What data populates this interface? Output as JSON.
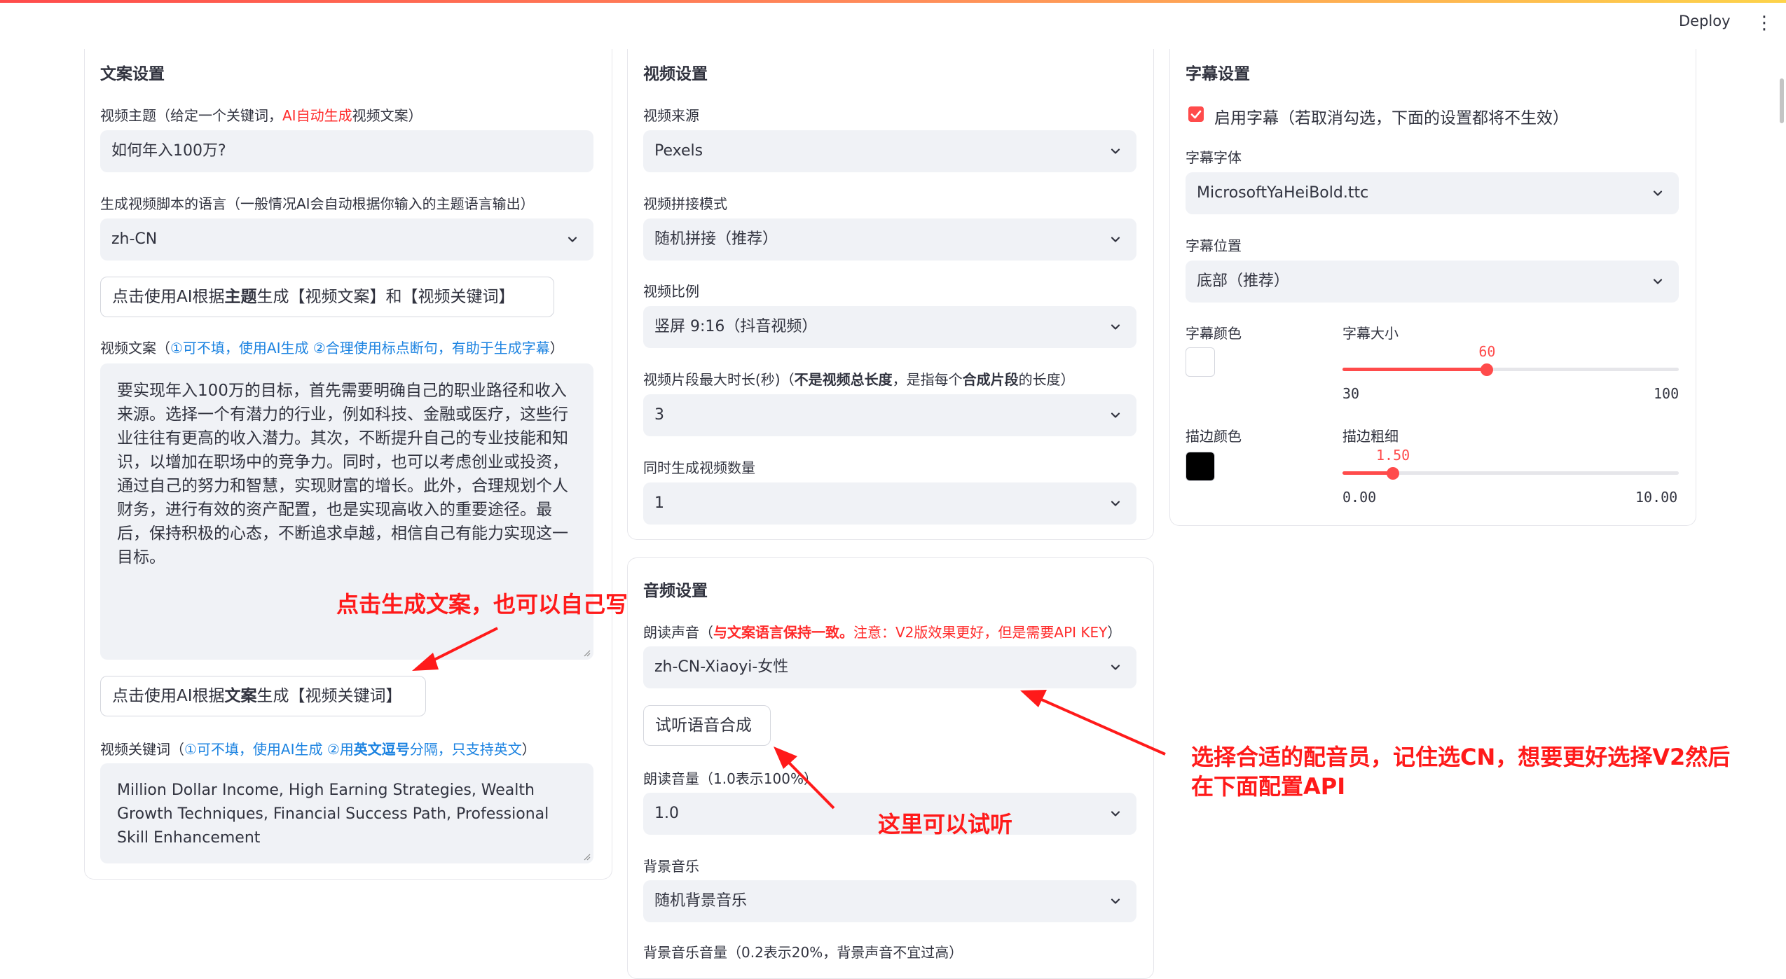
{
  "header": {
    "deploy_label": "Deploy",
    "menu_icon": "kebab-menu-icon"
  },
  "copy_settings": {
    "title": "文案设置",
    "topic_label_1": "视频主题（给定一个关键词，",
    "topic_label_red": "AI自动生成",
    "topic_label_2": "视频文案）",
    "topic_value": "如何年入100万?",
    "language_label": "生成视频脚本的语言（一般情况AI会自动根据你输入的主题语言输出）",
    "language_value": "zh-CN",
    "btn_generate_1": "点击使用AI根据",
    "btn_generate_bold": "主题",
    "btn_generate_2": "生成【视频文案】和【视频关键词】",
    "script_label_1": "视频文案（",
    "script_label_blue": "①可不填，使用AI生成 ②合理使用标点断句，有助于生成字幕",
    "script_label_2": "）",
    "script_text": "要实现年入100万的目标，首先需要明确自己的职业路径和收入来源。选择一个有潜力的行业，例如科技、金融或医疗，这些行业往往有更高的收入潜力。其次，不断提升自己的专业技能和知识，以增加在职场中的竞争力。同时，也可以考虑创业或投资，通过自己的努力和智慧，实现财富的增长。此外，合理规划个人财务，进行有效的资产配置，也是实现高收入的重要途径。最后，保持积极的心态，不断追求卓越，相信自己有能力实现这一目标。",
    "btn_keywords_1": "点击使用AI根据",
    "btn_keywords_bold": "文案",
    "btn_keywords_2": "生成【视频关键词】",
    "keywords_label_1": "视频关键词（",
    "keywords_label_blue_1": "①可不填，使用AI生成 ②用",
    "keywords_label_bold": "英文逗号",
    "keywords_label_blue_2": "分隔，只支持英文",
    "keywords_label_2": "）",
    "keywords_text": "Million Dollar Income, High Earning Strategies, Wealth Growth Techniques, Financial Success Path, Professional Skill Enhancement"
  },
  "video_settings": {
    "title": "视频设置",
    "source_label": "视频来源",
    "source_value": "Pexels",
    "concat_label": "视频拼接模式",
    "concat_value": "随机拼接（推荐）",
    "ratio_label": "视频比例",
    "ratio_value": "竖屏 9:16（抖音视频）",
    "clip_label_1": "视频片段最大时长(秒)（",
    "clip_label_bold_1": "不是视频总长度",
    "clip_label_2": "，是指每个",
    "clip_label_bold_2": "合成片段",
    "clip_label_3": "的长度）",
    "clip_value": "3",
    "count_label": "同时生成视频数量",
    "count_value": "1"
  },
  "audio_settings": {
    "title": "音频设置",
    "voice_label_1": "朗读声音（",
    "voice_label_red_bold": "与文案语言保持一致。",
    "voice_label_red": "注意：V2版效果更好，但是需要API KEY",
    "voice_label_2": "）",
    "voice_value": "zh-CN-Xiaoyi-女性",
    "btn_preview": "试听语音合成",
    "volume_label": "朗读音量（1.0表示100%）",
    "volume_value": "1.0",
    "bgm_label": "背景音乐",
    "bgm_value": "随机背景音乐",
    "bgm_volume_label": "背景音乐音量（0.2表示20%，背景声音不宜过高）"
  },
  "subtitle_settings": {
    "title": "字幕设置",
    "enable_label": "启用字幕（若取消勾选，下面的设置都将不生效）",
    "enable_checked": true,
    "font_label": "字幕字体",
    "font_value": "MicrosoftYaHeiBold.ttc",
    "position_label": "字幕位置",
    "position_value": "底部（推荐）",
    "color_label": "字幕颜色",
    "color_value": "#ffffff",
    "size_label": "字幕大小",
    "size_value": "60",
    "size_min": "30",
    "size_max": "100",
    "size_fraction": 0.43,
    "stroke_color_label": "描边颜色",
    "stroke_color_value": "#000000",
    "stroke_width_label": "描边粗细",
    "stroke_width_value": "1.50",
    "stroke_min": "0.00",
    "stroke_max": "10.00",
    "stroke_fraction": 0.15
  },
  "annotations": {
    "generate_tip": "点击生成文案，也可以自己写",
    "voice_tip_line1": "选择合适的配音员，记住选CN，想要更好选择V2然后",
    "voice_tip_line2": "在下面配置API",
    "preview_tip": "这里可以试听"
  },
  "colors": {
    "accent": "#ff4b4b",
    "annotation": "#ff1a1a",
    "link": "#1c83e1",
    "field_bg": "#f0f2f6"
  }
}
